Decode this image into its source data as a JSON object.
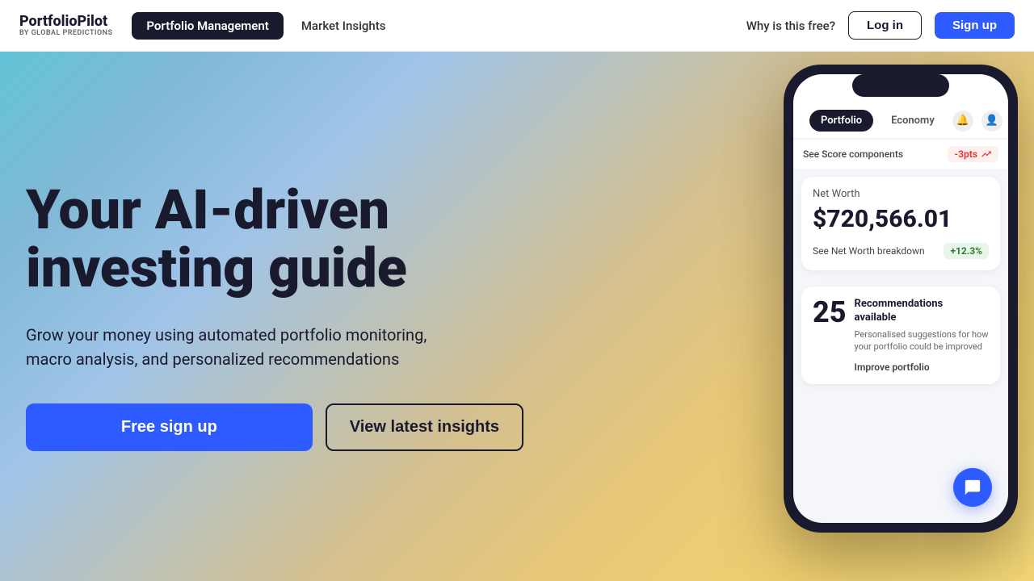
{
  "nav": {
    "logo_title": "PortfolioPilot",
    "logo_sub": "BY GLOBAL PREDICTIONS",
    "link_portfolio": "Portfolio Management",
    "link_insights": "Market Insights",
    "why_free": "Why is this free?",
    "login_label": "Log in",
    "signup_label": "Sign up"
  },
  "hero": {
    "headline_line1": "Your AI-driven",
    "headline_line2": "investing guide",
    "subtext": "Grow your money using automated portfolio monitoring, macro analysis, and personalized recommendations",
    "btn_free_signup": "Free sign up",
    "btn_view_insights": "View latest insights"
  },
  "phone": {
    "tab_portfolio": "Portfolio",
    "tab_economy": "Economy",
    "score_label": "See Score components",
    "score_badge": "-3pts",
    "nw_label": "Net Worth",
    "nw_value": "$720,566.01",
    "nw_breakdown": "See Net Worth breakdown",
    "nw_green": "+12.3%",
    "rec_number": "25",
    "rec_title_line1": "Recommendations",
    "rec_title_line2": "available",
    "rec_desc": "Personalised suggestions for how your portfolio could be improved",
    "rec_btn": "Improve portfolio"
  }
}
